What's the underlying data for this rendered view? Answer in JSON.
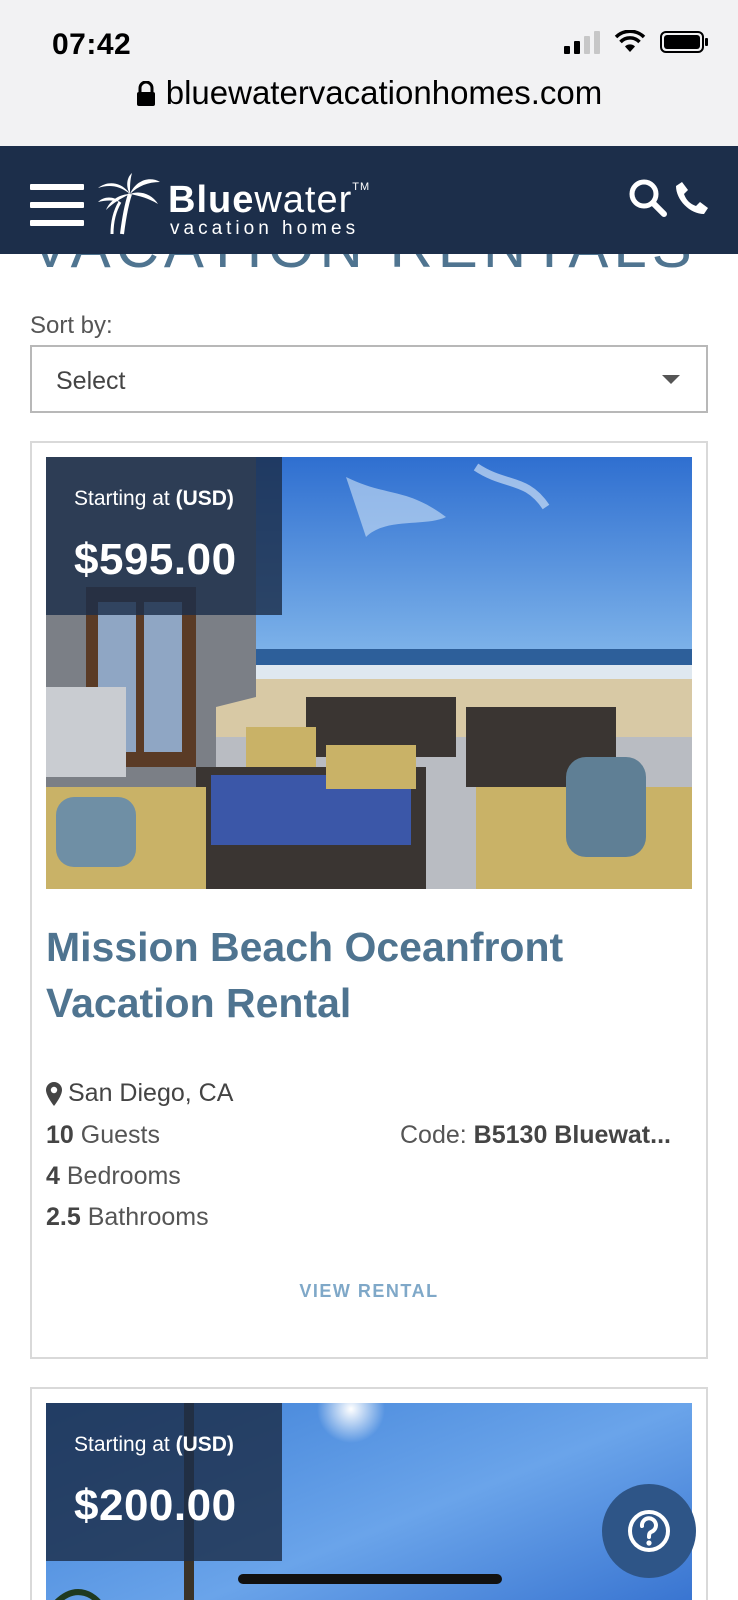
{
  "status_bar": {
    "time": "07:42",
    "url": "bluewatervacationhomes.com"
  },
  "nav": {
    "logo_main_bold": "Blue",
    "logo_main_rest": "water",
    "logo_tm": "TM",
    "logo_sub": "vacation homes"
  },
  "page": {
    "partial_heading": "VACATION RENTALS"
  },
  "sort": {
    "label": "Sort by:",
    "selected": "Select"
  },
  "listings": [
    {
      "price_caption": "Starting at",
      "currency": "(USD)",
      "price": "$595.00",
      "title": "Mission Beach Oceanfront Vacation Rental",
      "location": "San Diego, CA",
      "guests_num": "10",
      "guests_label": "Guests",
      "bedrooms_num": "4",
      "bedrooms_label": "Bedrooms",
      "bathrooms_num": "2.5",
      "bathrooms_label": "Bathrooms",
      "code_label": "Code:",
      "code_value": "B5130 Bluewat...",
      "cta": "VIEW RENTAL"
    },
    {
      "price_caption": "Starting at",
      "currency": "(USD)",
      "price": "$200.00"
    }
  ],
  "colors": {
    "nav_bg": "#1c2e4a",
    "title_blue": "#4f7490",
    "cta_blue": "#7fa8c8",
    "help_bg": "#2e5587"
  }
}
